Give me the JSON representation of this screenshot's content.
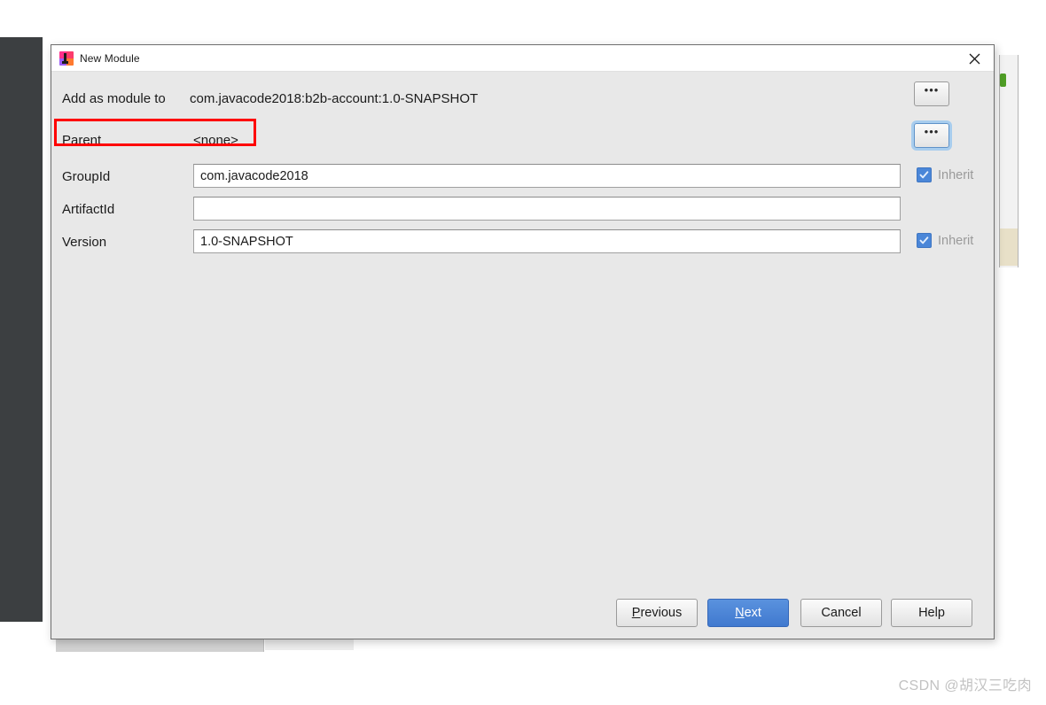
{
  "window": {
    "title": "New Module",
    "icon": "intellij-idea-logo-icon",
    "close_label": "✕"
  },
  "form": {
    "add_as_module_label": "Add as module to",
    "add_as_module_value": "com.javacode2018:b2b-account:1.0-SNAPSHOT",
    "add_as_module_browse": "•••",
    "parent_label": "Parent",
    "parent_value": "<none>",
    "parent_browse": "•••",
    "groupid_label": "GroupId",
    "groupid_value": "com.javacode2018",
    "groupid_placeholder": "",
    "groupid_inherit_label": "Inherit",
    "artifactid_label": "ArtifactId",
    "artifactid_value": "",
    "artifactid_placeholder": "",
    "version_label": "Version",
    "version_value": "1.0-SNAPSHOT",
    "version_placeholder": "",
    "version_inherit_label": "Inherit"
  },
  "footer": {
    "previous_label": "Previous",
    "previous_mnemonic": "P",
    "next_label": "Next",
    "next_mnemonic": "N",
    "cancel_label": "Cancel",
    "help_label": "Help"
  },
  "annotation": {
    "color": "#ff0000",
    "target": "parent-row"
  },
  "watermark": {
    "text": "CSDN @胡汉三吃肉"
  },
  "colors": {
    "accent_blue": "#4a86d8",
    "dialog_bg": "#e8e8e8",
    "titlebar_bg": "#ffffff",
    "annotation_red": "#ff0000",
    "disabled_text": "#9a9a9a"
  }
}
